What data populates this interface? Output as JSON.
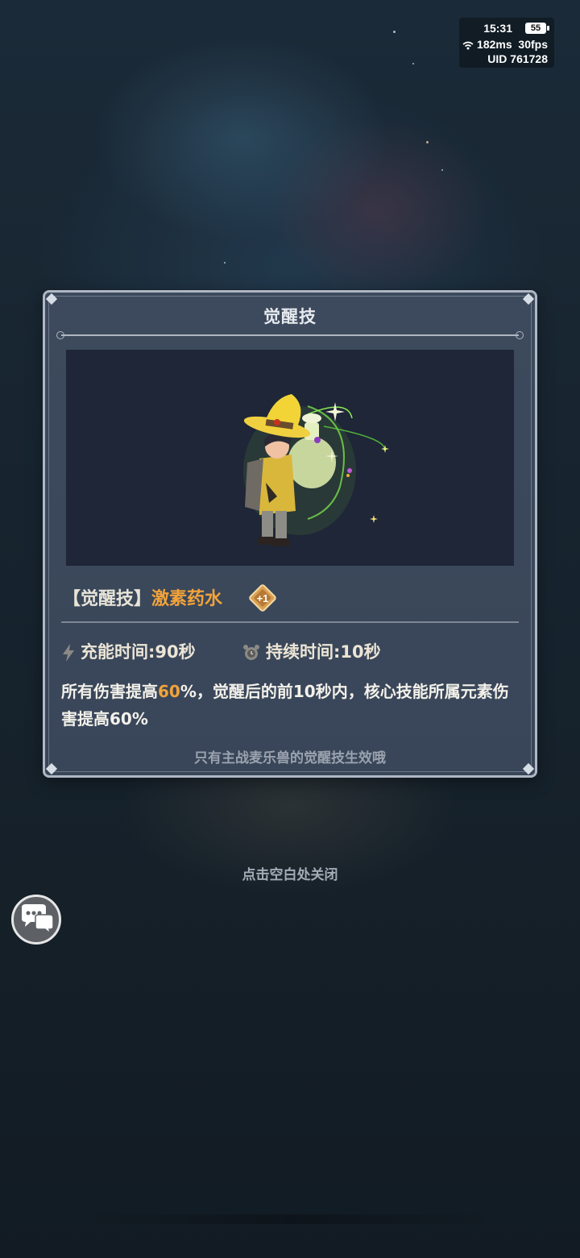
{
  "status_bar": {
    "time": "15:31",
    "battery": "55",
    "latency": "182ms",
    "fps": "30fps",
    "uid": "UID 761728"
  },
  "dialog": {
    "title": "觉醒技",
    "skill_bracket": "【觉醒技】",
    "skill_name": "激素药水",
    "skill_level_badge": "+1",
    "charge_time": "充能时间:90秒",
    "duration": "持续时间:10秒",
    "description_prefix": "所有伤害提高",
    "description_highlight": "60",
    "description_suffix": "%，觉醒后的前10秒内，核心技能所属元素伤害提高60%",
    "note": "只有主战麦乐兽的觉醒技生效哦"
  },
  "close_hint": "点击空白处关闭",
  "chat_button_icon": "chat-bubbles-icon",
  "colors": {
    "accent_orange": "#f2a33a",
    "dialog_bg": "#3b485b",
    "dialog_border": "#aeb7c3",
    "preview_bg": "#1e2637"
  }
}
